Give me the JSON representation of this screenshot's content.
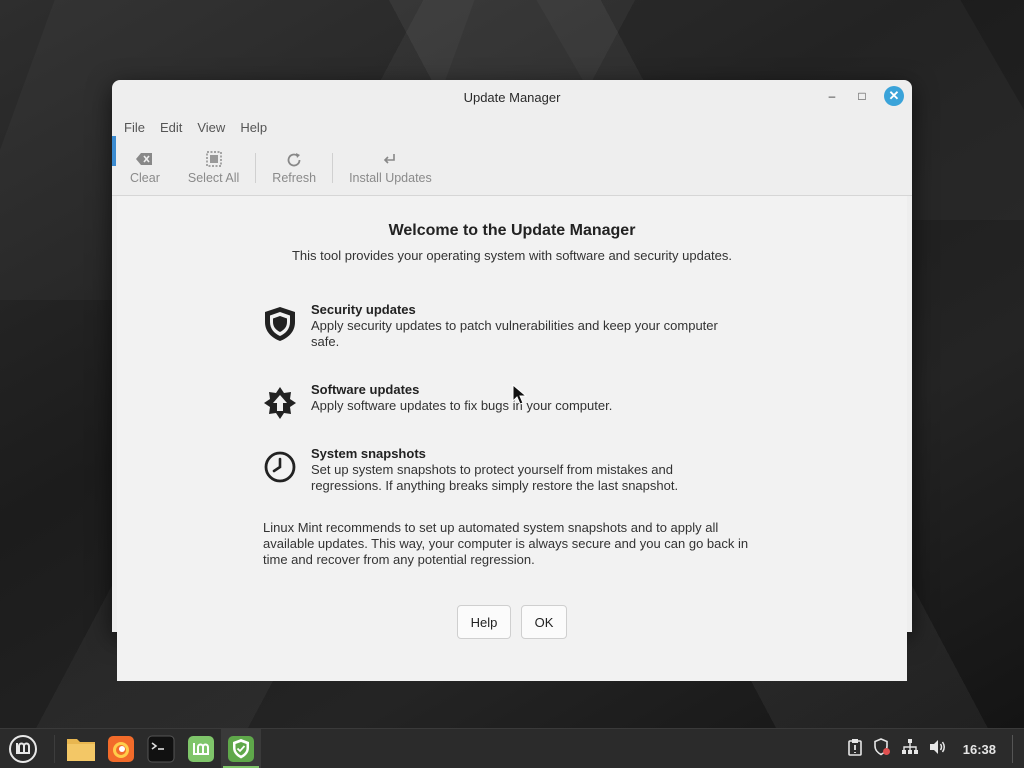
{
  "window": {
    "title": "Update Manager",
    "minimize_glyph": "–",
    "maximize_glyph": "□",
    "close_glyph": "✕"
  },
  "menubar": [
    "File",
    "Edit",
    "View",
    "Help"
  ],
  "toolbar": {
    "clear": {
      "label": "Clear",
      "icon": "clear-icon"
    },
    "select_all": {
      "label": "Select All",
      "icon": "select-all-icon"
    },
    "refresh": {
      "label": "Refresh",
      "icon": "refresh-icon"
    },
    "install": {
      "label": "Install Updates",
      "icon": "install-icon"
    }
  },
  "welcome": {
    "title": "Welcome to the Update Manager",
    "subtitle": "This tool provides your operating system with software and security updates.",
    "features": [
      {
        "heading": "Security updates",
        "description": "Apply security updates to patch vulnerabilities and keep your computer safe.",
        "icon": "shield-icon"
      },
      {
        "heading": "Software updates",
        "description": "Apply software updates to fix bugs in your computer.",
        "icon": "upgrade-star-icon"
      },
      {
        "heading": "System snapshots",
        "description": "Set up system snapshots to protect yourself from mistakes and regressions. If anything breaks simply restore the last snapshot.",
        "icon": "clock-icon"
      }
    ],
    "recommendation": "Linux Mint recommends to set up automated system snapshots and to apply all available updates. This way, your computer is always secure and you can go back in time and recover from any potential regression.",
    "help_button": "Help",
    "ok_button": "OK"
  },
  "taskbar": {
    "apps": [
      {
        "name": "files",
        "icon": "folder-icon"
      },
      {
        "name": "firefox",
        "icon": "firefox-icon"
      },
      {
        "name": "terminal",
        "icon": "terminal-icon"
      },
      {
        "name": "mintinstall",
        "icon": "mint-icon"
      },
      {
        "name": "update-manager",
        "icon": "shield-update-icon",
        "active": true
      }
    ],
    "clock": "16:38"
  },
  "colors": {
    "accent": "#3aa3d9",
    "mint_green": "#7fc56a",
    "taskbar_bg": "#2b2b2b"
  }
}
